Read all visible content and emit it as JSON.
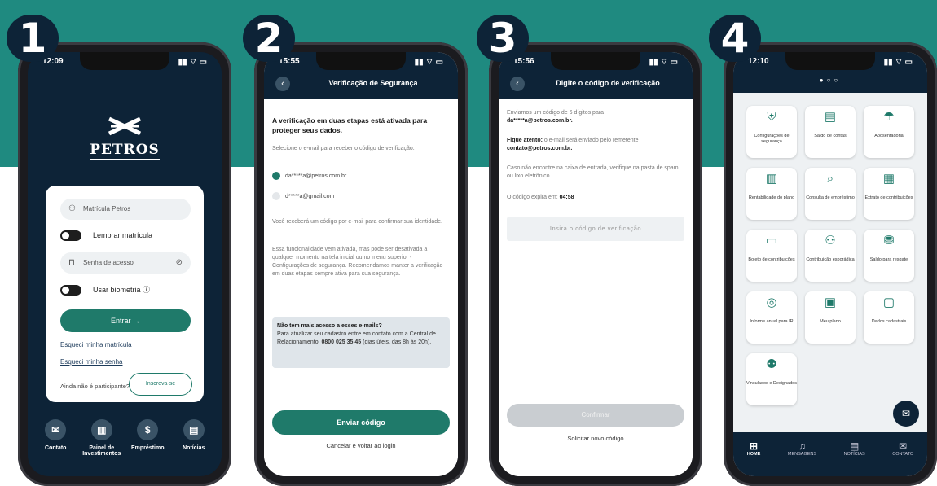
{
  "steps": [
    "1",
    "2",
    "3",
    "4"
  ],
  "phone1": {
    "time": "12:09",
    "logo_text": "PETROS",
    "matricula_placeholder": "Matrícula Petros",
    "remember_label": "Lembrar matrícula",
    "password_placeholder": "Senha de acesso",
    "biometry_label": "Usar biometria",
    "enter_label": "Entrar",
    "forgot_matricula": "Esqueci minha matrícula",
    "forgot_password": "Esqueci minha senha",
    "not_participant": "Ainda não é participante?",
    "signup_label": "Inscreva-se",
    "nav": [
      "Contato",
      "Painel de Investimentos",
      "Empréstimo",
      "Notícias"
    ]
  },
  "phone2": {
    "time": "15:55",
    "title": "Verificação de Segurança",
    "heading": "A verificação em duas etapas está ativada para proteger seus dados.",
    "select_text": "Selecione o e-mail para receber o código de verificação.",
    "option1": "da*****a@petros.com.br",
    "option2": "d*****a@gmail.com",
    "receive_text": "Você receberá um código por e-mail para confirmar sua identidade.",
    "info_text": "Essa funcionalidade vem ativada, mas pode ser desativada a qualquer momento na tela inicial ou no menu superior - Configurações de segurança. Recomendamos manter a verificação em duas etapas sempre ativa para sua segurança.",
    "box_title": "Não tem mais acesso a esses e-mails?",
    "box_text": "Para atualizar seu cadastro entre em contato com a Central de Relacionamento:",
    "box_phone": "0800 025 35 45",
    "box_hours": "(dias úteis, das 8h às 20h).",
    "send_label": "Enviar código",
    "cancel_label": "Cancelar e voltar ao login"
  },
  "phone3": {
    "time": "15:56",
    "title": "Digite o código de verificação",
    "sent_text": "Enviamos um código de 6 dígitos para",
    "sent_email": "da*****a@petros.com.br.",
    "attention_bold": "Fique atento:",
    "attention_text": "o e-mail será enviado pelo remetente",
    "sender": "contato@petros.com.br.",
    "spam_text": "Caso não encontre na caixa de entrada, verifique na pasta de spam ou lixo eletrônico.",
    "expires_label": "O código expira em:",
    "expires_value": "04:58",
    "code_placeholder": "Insira o código de verificação",
    "confirm_label": "Confirmar",
    "resend_label": "Solicitar novo código"
  },
  "phone4": {
    "time": "12:10",
    "tiles": [
      {
        "icon": "shield-icon",
        "glyph": "⛨",
        "label": "Configurações de segurança"
      },
      {
        "icon": "document-icon",
        "glyph": "▤",
        "label": "Saldo de contas"
      },
      {
        "icon": "umbrella-icon",
        "glyph": "☂",
        "label": "Aposentadoria"
      },
      {
        "icon": "chart-icon",
        "glyph": "▥",
        "label": "Rentabilidade do plano"
      },
      {
        "icon": "search-icon",
        "glyph": "⌕",
        "label": "Consulta de empréstimo"
      },
      {
        "icon": "statement-icon",
        "glyph": "▦",
        "label": "Extrato de contribuições"
      },
      {
        "icon": "barcode-icon",
        "glyph": "▭",
        "label": "Boleto de contribuições"
      },
      {
        "icon": "person-icon",
        "glyph": "⚇",
        "label": "Contribuição esporádica"
      },
      {
        "icon": "hand-money-icon",
        "glyph": "⛃",
        "label": "Saldo para resgate"
      },
      {
        "icon": "tax-icon",
        "glyph": "◎",
        "label": "Informe anual para IR"
      },
      {
        "icon": "plan-icon",
        "glyph": "▣",
        "label": "Meu plano"
      },
      {
        "icon": "id-card-icon",
        "glyph": "▢",
        "label": "Dados cadastrais"
      },
      {
        "icon": "people-icon",
        "glyph": "⚉",
        "label": "Vinculados e Designados"
      }
    ],
    "nav": [
      "HOME",
      "MENSAGENS",
      "NOTÍCIAS",
      "CONTATO"
    ]
  },
  "colors": {
    "teal": "#1f8a80",
    "navy": "#0d2337",
    "green": "#1f7a6a"
  }
}
